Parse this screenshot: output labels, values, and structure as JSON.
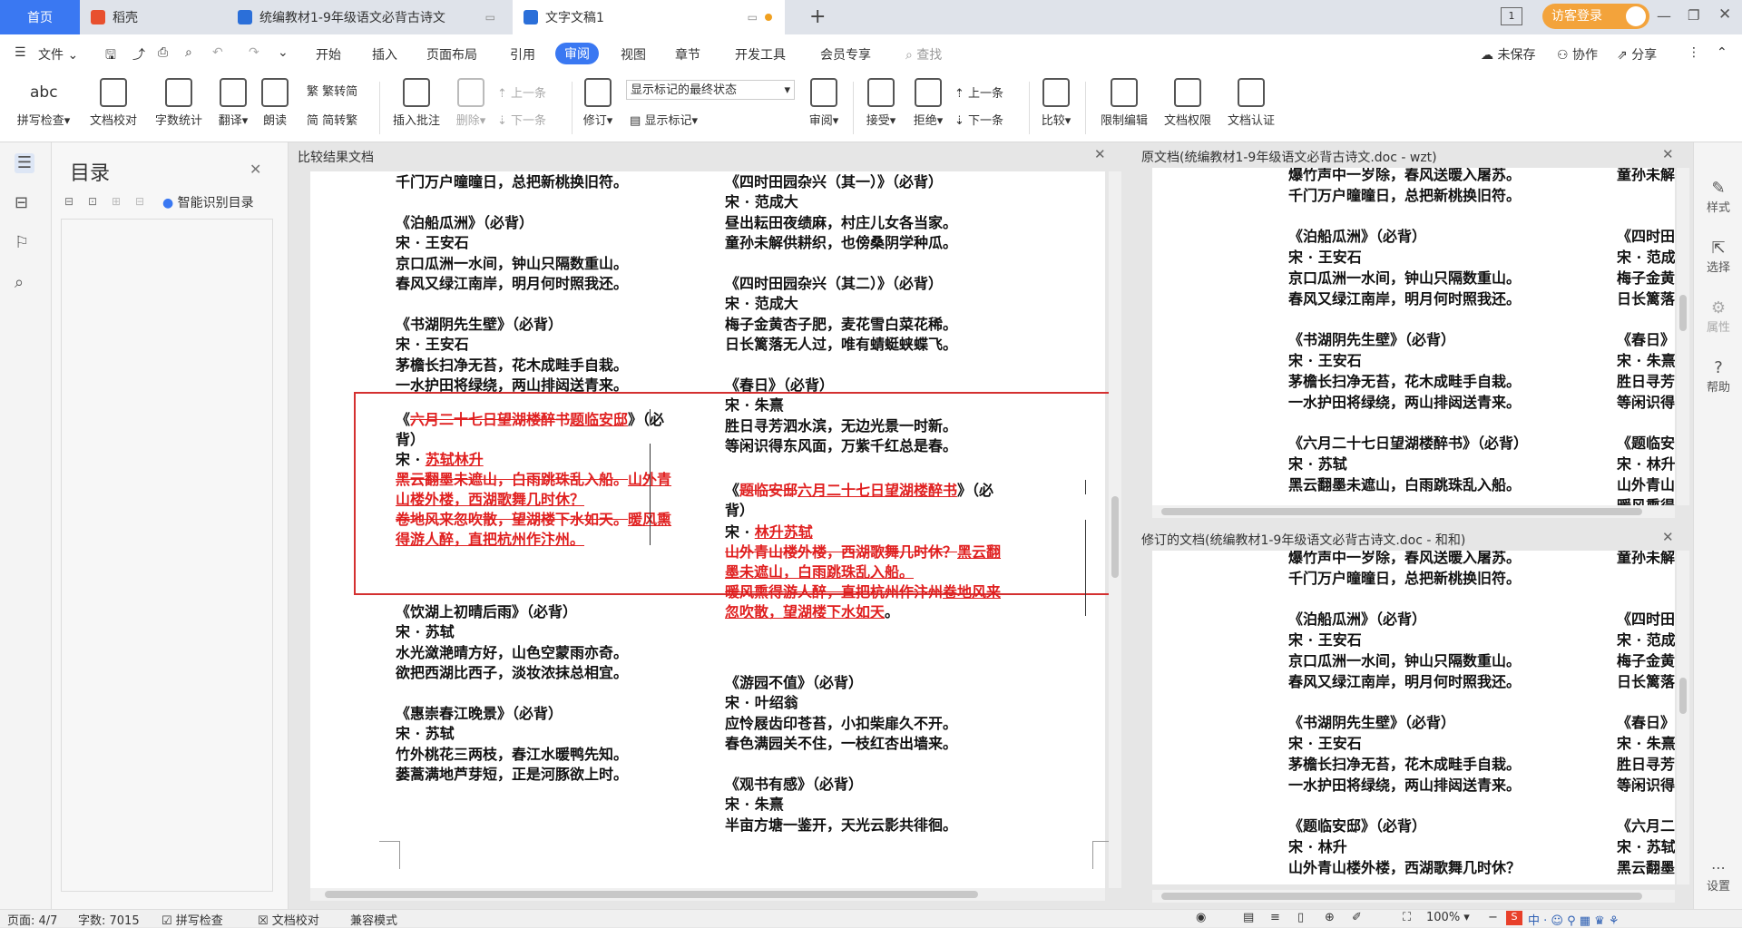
{
  "tabs": {
    "home": "首页",
    "daoke": "稻壳",
    "doc_compiled": "统编教材1-9年级语文必背古诗文",
    "doc_new": "文字文稿1",
    "guest_login": "访客登录"
  },
  "menu": {
    "file": "文件",
    "items": [
      "开始",
      "插入",
      "页面布局",
      "引用",
      "审阅",
      "视图",
      "章节",
      "开发工具",
      "会员专享"
    ],
    "search": "查找",
    "unsaved": "未保存",
    "collab": "协作",
    "share": "分享"
  },
  "ribbon": {
    "spellcheck": "拼写检查",
    "doc_proof": "文档校对",
    "word_count": "字数统计",
    "translate": "翻译",
    "read_aloud": "朗读",
    "to_traditional": "繁转简",
    "to_simplified": "简转繁",
    "insert_comment": "插入批注",
    "delete": "删除",
    "prev": "上一条",
    "next": "下一条",
    "revise": "修订",
    "markup_select": "显示标记的最终状态",
    "show_markup": "显示标记",
    "review": "审阅",
    "accept": "接受",
    "reject": "拒绝",
    "prev2": "上一条",
    "next2": "下一条",
    "compare": "比较",
    "restrict_edit": "限制编辑",
    "doc_rights": "文档权限",
    "doc_cert": "文档认证"
  },
  "toc": {
    "title": "目录",
    "smart_toc": "智能识别目录"
  },
  "compare_panel": {
    "title": "比较结果文档",
    "left_col": [
      "千门万户曈曈日，总把新桃换旧符。",
      "",
      "《泊船瓜洲》（必背）",
      "宋 · 王安石",
      "京口瓜洲一水间，钟山只隔数重山。",
      "春风又绿江南岸，明月何时照我还。",
      "",
      "《书湖阴先生壁》（必背）",
      "宋 · 王安石",
      "茅檐长扫净无苔，花木成畦手自栽。",
      "一水护田将绿绕，两山排闼送青来。"
    ],
    "left_box": {
      "l1_pre": "《",
      "l1_del": "六月二十七日望湖楼醉书",
      "l1_ins": "题临安邸",
      "l1_post": "》（必",
      "l2": "背）",
      "l3_pre": "宋 · ",
      "l3_ins": "苏轼林升",
      "l4_del": "黑云翻墨未遮山，白雨跳珠乱入船。",
      "l4_ins": "山外青",
      "l5_ins": "山楼外楼，西湖歌舞几时休？",
      "l6_del": "卷地风来忽吹散，望湖楼下水如天。",
      "l6_ins": "暖风熏",
      "l7_ins": "得游人醉，直把杭州作汴州。"
    },
    "left_col2": [
      "《饮湖上初晴后雨》（必背）",
      "宋 · 苏轼",
      "水光潋滟晴方好，山色空蒙雨亦奇。",
      "欲把西湖比西子，淡妆浓抹总相宜。",
      "",
      "《惠崇春江晚景》（必背）",
      "宋 · 苏轼",
      "竹外桃花三两枝，春江水暖鸭先知。",
      "蒌蒿满地芦芽短，正是河豚欲上时。"
    ],
    "right_col": [
      "《四时田园杂兴（其一）》（必背）",
      "宋 · 范成大",
      "昼出耘田夜绩麻，村庄儿女各当家。",
      "童孙未解供耕织，也傍桑阴学种瓜。",
      "",
      "《四时田园杂兴（其二）》（必背）",
      "宋 · 范成大",
      "梅子金黄杏子肥，麦花雪白菜花稀。",
      "日长篱落无人过，唯有蜻蜓蛱蝶飞。",
      "",
      "《春日》（必背）",
      "宋 · 朱熹",
      "胜日寻芳泗水滨，无边光景一时新。",
      "等闲识得东风面，万紫千红总是春。"
    ],
    "right_box": {
      "l1_pre": "《",
      "l1_del": "题临安邸",
      "l1_ins": "六月二十七日望湖楼醉书",
      "l1_post": "》（必",
      "l2": "背）",
      "l3_pre": "宋 · ",
      "l3_ins": "林升苏轼",
      "l4_del": "山外青山楼外楼，西湖歌舞几时休？",
      "l4_ins": "黑云翻",
      "l5_ins": "墨未遮山，白雨跳珠乱入船。",
      "l6_del": "暖风熏得游人醉，直把杭州作汴州",
      "l6_ins": "卷地风来",
      "l7_ins": "忽吹散，望湖楼下水如天",
      "l7_post": "。"
    },
    "right_col2": [
      "《游园不值》（必背）",
      "宋 · 叶绍翁",
      "应怜屐齿印苍苔，小扣柴扉久不开。",
      "春色满园关不住，一枝红杏出墙来。",
      "",
      "《观书有感》（必背）",
      "宋 · 朱熹",
      "半亩方塘一鉴开，天光云影共徘徊。"
    ]
  },
  "original_panel": {
    "title": "原文档(统编教材1-9年级语文必背古诗文.doc - wzt)",
    "col_a": [
      "爆竹声中一岁除，春风送暖入屠苏。",
      "千门万户曈曈日，总把新桃换旧符。",
      "",
      "《泊船瓜洲》（必背）",
      "宋 · 王安石",
      "京口瓜洲一水间，钟山只隔数重山。",
      "春风又绿江南岸，明月何时照我还。",
      "",
      "《书湖阴先生壁》（必背）",
      "宋 · 王安石",
      "茅檐长扫净无苔，花木成畦手自栽。",
      "一水护田将绿绕，两山排闼送青来。",
      "",
      "《六月二十七日望湖楼醉书》（必背）",
      "宋 · 苏轼",
      "黑云翻墨未遮山，白雨跳珠乱入船。"
    ],
    "col_b": [
      "童孙未解",
      "",
      "",
      "《四时田",
      "宋 · 范成",
      "梅子金黄",
      "日长篱落",
      "",
      "《春日》",
      "宋 · 朱熹",
      "胜日寻芳",
      "等闲识得",
      "",
      "《题临安",
      "宋 · 林升",
      "山外青山",
      "暖风熏得"
    ]
  },
  "revised_panel": {
    "title": "修订的文档(统编教材1-9年级语文必背古诗文.doc - 和和)",
    "col_a": [
      "爆竹声中一岁除，春风送暖入屠苏。",
      "千门万户曈曈日，总把新桃换旧符。",
      "",
      "《泊船瓜洲》（必背）",
      "宋 · 王安石",
      "京口瓜洲一水间，钟山只隔数重山。",
      "春风又绿江南岸，明月何时照我还。",
      "",
      "《书湖阴先生壁》（必背）",
      "宋 · 王安石",
      "茅檐长扫净无苔，花木成畦手自栽。",
      "一水护田将绿绕，两山排闼送青来。",
      "",
      "《题临安邸》（必背）",
      "宋 · 林升",
      "山外青山楼外楼，西湖歌舞几时休？"
    ],
    "col_b": [
      "童孙未解",
      "",
      "",
      "《四时田",
      "宋 · 范成",
      "梅子金黄",
      "日长篱落",
      "",
      "《春日》",
      "宋 · 朱熹",
      "胜日寻芳",
      "等闲识得",
      "",
      "《六月二",
      "宋 · 苏轼",
      "黑云翻墨"
    ]
  },
  "right_rail": {
    "style": "样式",
    "select": "选择",
    "properties": "属性",
    "help": "帮助",
    "settings": "设置"
  },
  "status": {
    "page": "页面: 4/7",
    "words": "字数: 7015",
    "spellcheck": "拼写检查",
    "doc_proof": "文档校对",
    "compat": "兼容模式",
    "zoom": "100%"
  }
}
